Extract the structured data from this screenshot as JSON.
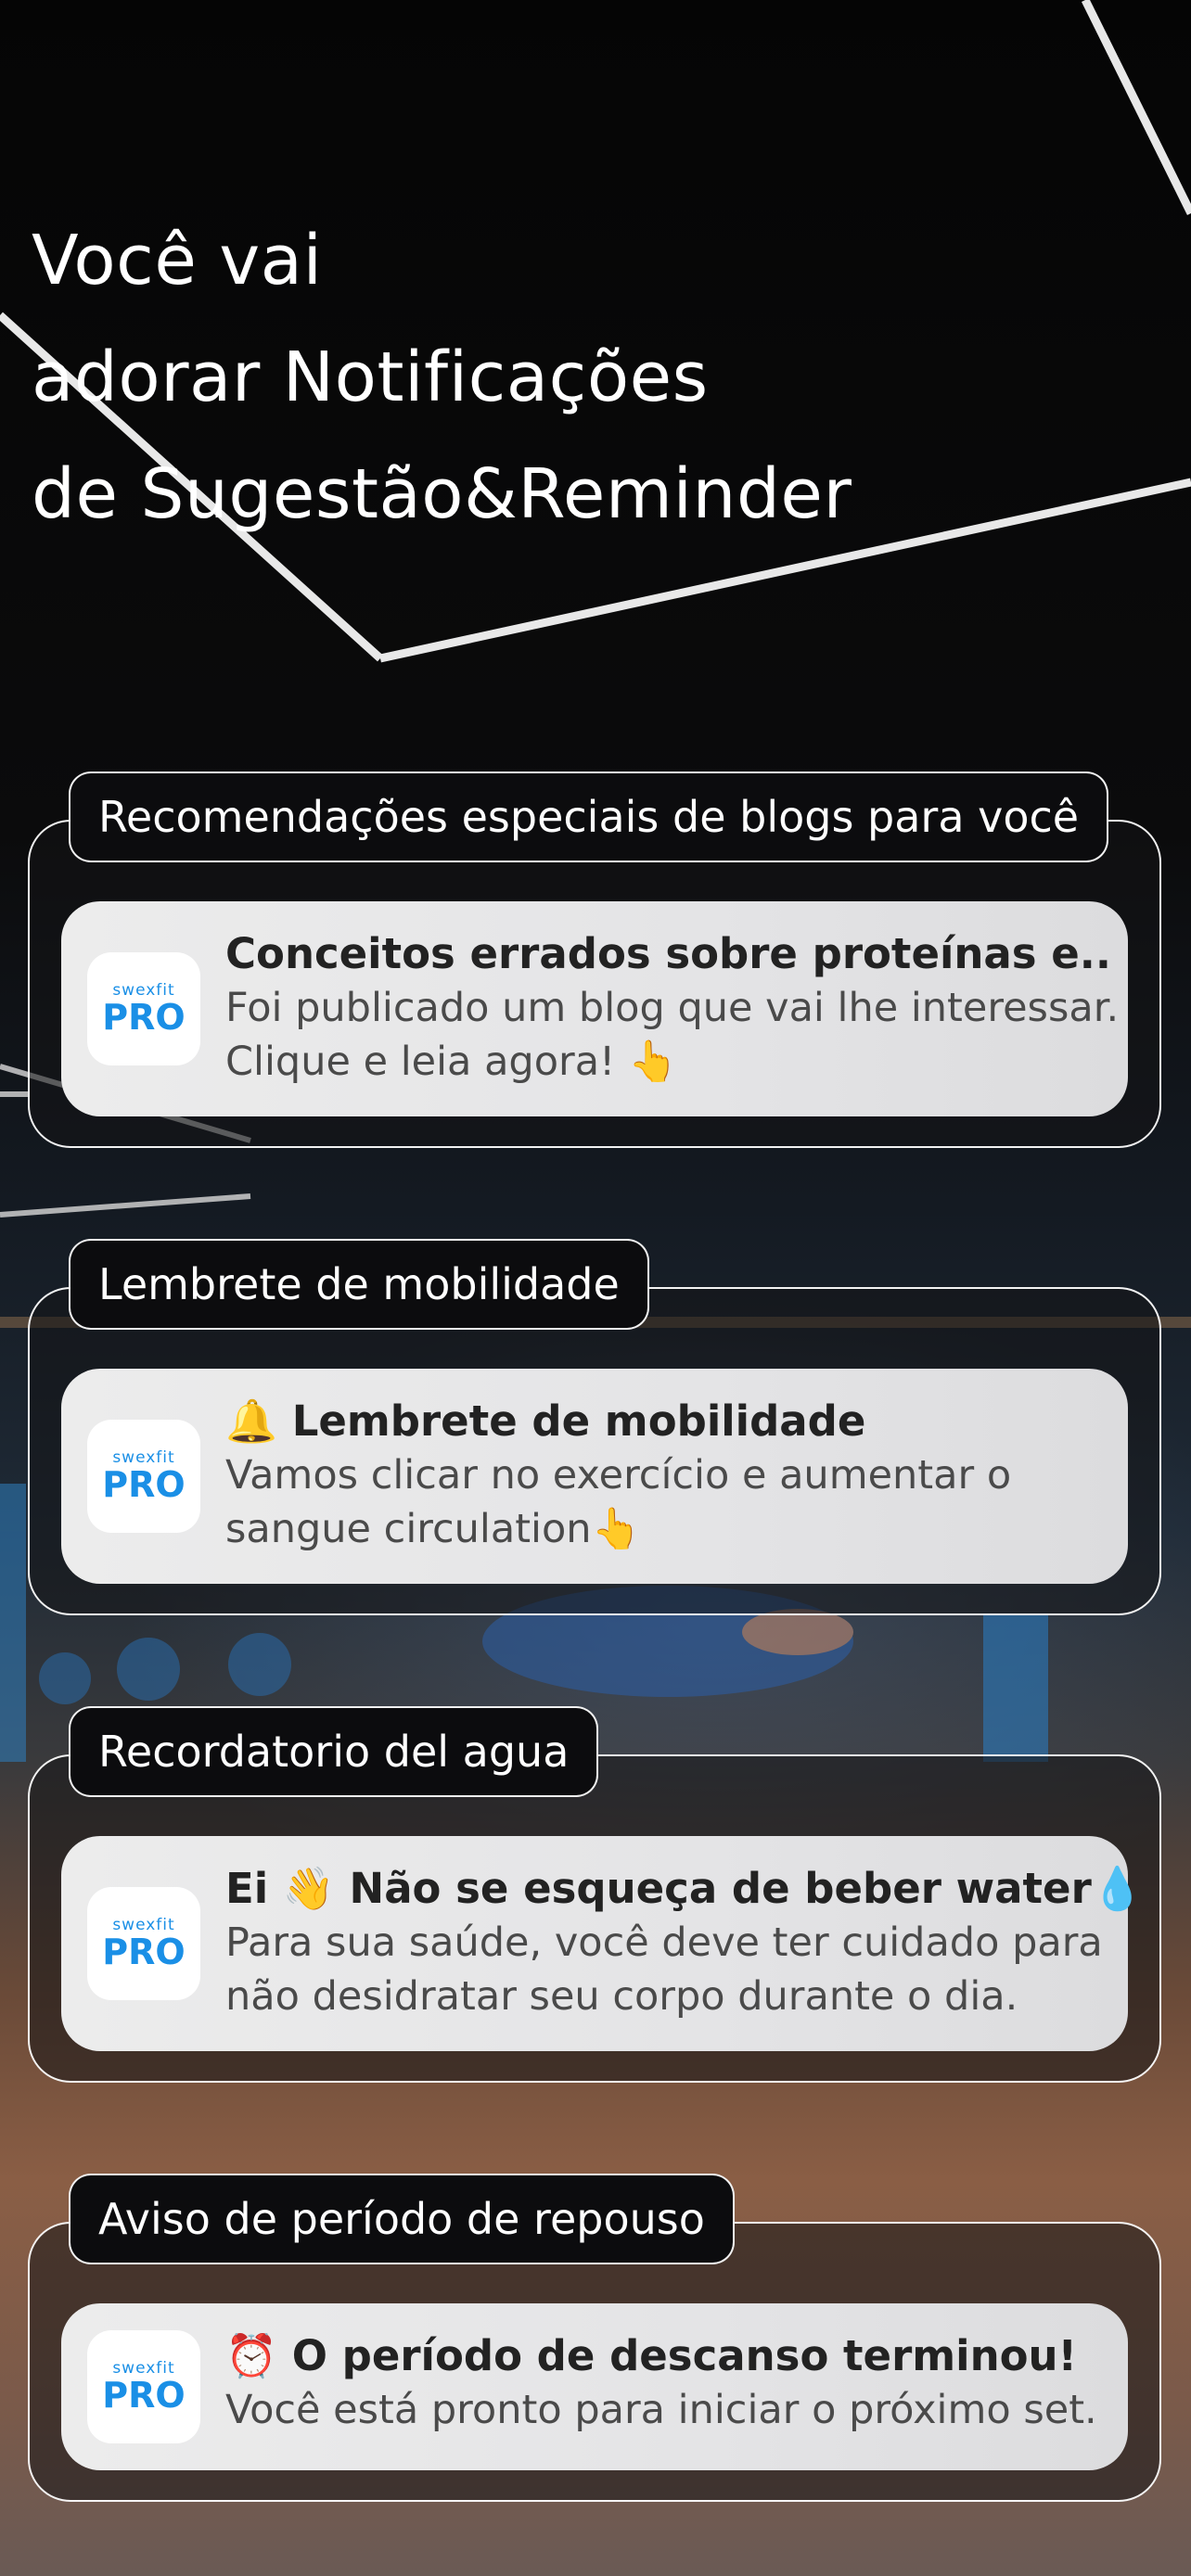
{
  "headline": {
    "line1": "Você vai",
    "line2": "adorar Notificações",
    "line3": "de Sugestão&Reminder"
  },
  "app_icon": {
    "brand": "swexfit",
    "badge": "PRO"
  },
  "sections": [
    {
      "tab_label": "Recomendações especiais de blogs para você",
      "title": "Conceitos errados sobre proteínas e..",
      "body_line1": "Foi publicado um blog que vai lhe interessar.",
      "body_line2": "Clique e leia agora! 👆"
    },
    {
      "tab_label": "Lembrete de mobilidade",
      "title": "🔔 Lembrete de mobilidade",
      "body_line1": "Vamos clicar no exercício e aumentar o",
      "body_line2": "sangue circulation👆"
    },
    {
      "tab_label": "Recordatorio del agua",
      "title": "Ei 👋 Não se esqueça de beber water💧",
      "body_line1": "Para sua saúde, você deve ter cuidado para",
      "body_line2": "não desidratar seu corpo durante o dia."
    },
    {
      "tab_label": "Aviso de período de repouso",
      "title": "⏰ O período de descanso terminou!",
      "body_line1": "Você está pronto para iniciar o próximo set."
    }
  ]
}
